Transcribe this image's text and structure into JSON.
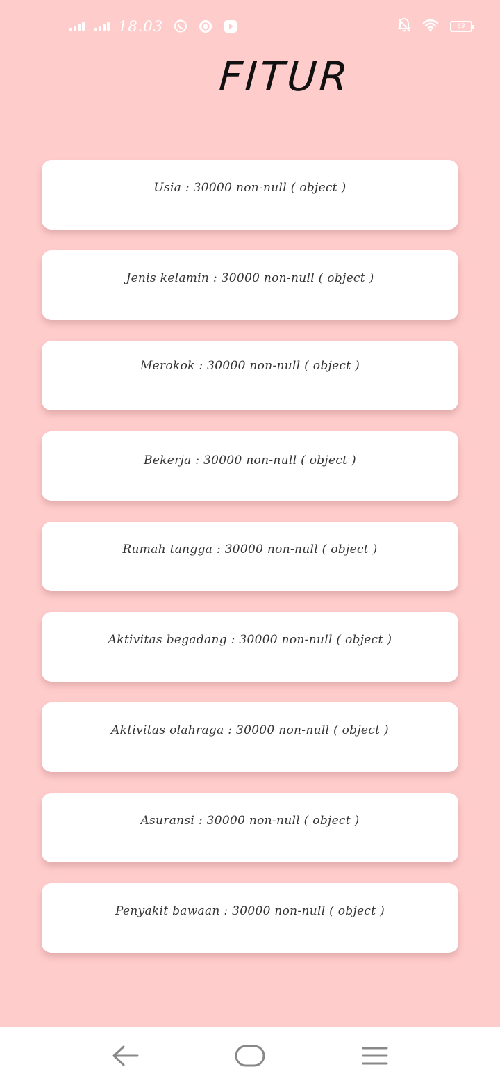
{
  "status_bar": {
    "time": "18.03",
    "battery_level": "63",
    "icons_left": [
      "signal-icon",
      "signal-icon",
      "whatsapp-icon",
      "music-app-icon",
      "youtube-icon"
    ],
    "icons_right": [
      "notifications-off-icon",
      "wifi-icon",
      "battery-icon"
    ],
    "icon_color": "#ffffff"
  },
  "page": {
    "title": "FITUR",
    "background_color": "#ffcccc"
  },
  "features": [
    {
      "text": "Usia :  30000 non-null ( object )"
    },
    {
      "text": "Jenis kelamin : 30000 non-null ( object )"
    },
    {
      "text": "Merokok : 30000 non-null ( object )"
    },
    {
      "text": "Bekerja : 30000 non-null ( object )"
    },
    {
      "text": "Rumah tangga : 30000 non-null ( object )"
    },
    {
      "text": "Aktivitas begadang : 30000 non-null ( object )"
    },
    {
      "text": "Aktivitas olahraga : 30000 non-null ( object )"
    },
    {
      "text": "Asuransi : 30000 non-null ( object )"
    },
    {
      "text": "Penyakit bawaan : 30000 non-null ( object )"
    }
  ],
  "nav_bar": {
    "buttons": [
      "back-icon",
      "home-icon",
      "menu-icon"
    ],
    "icon_color": "#888888"
  }
}
